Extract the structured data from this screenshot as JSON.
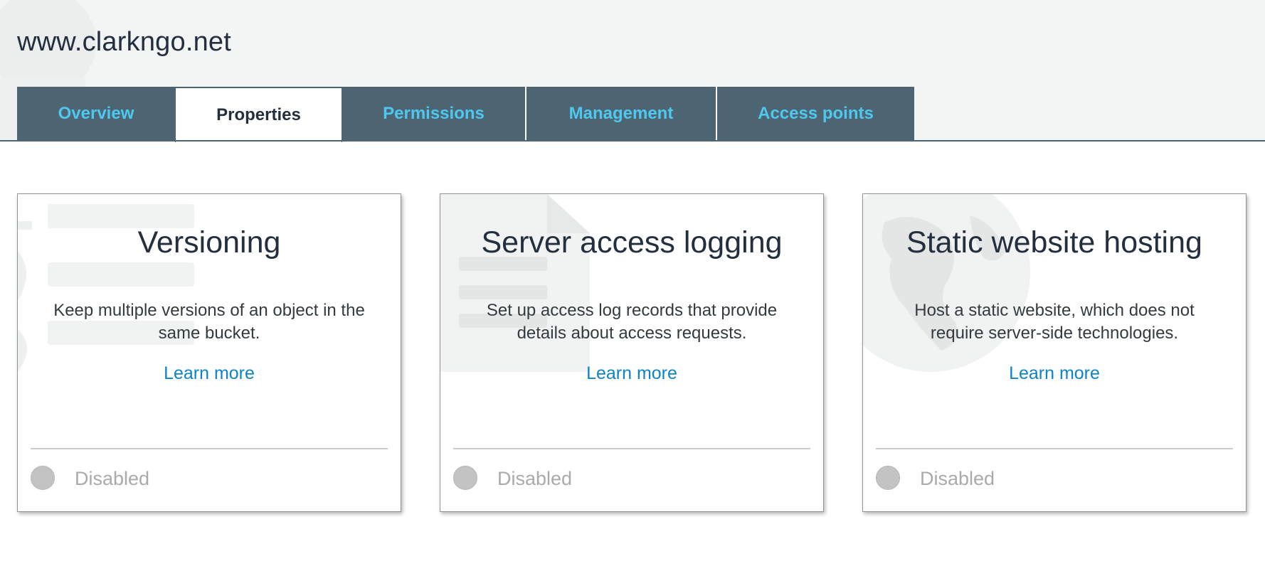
{
  "bucket": {
    "title": "www.clarkngo.net"
  },
  "tabs": [
    {
      "label": "Overview",
      "active": false
    },
    {
      "label": "Properties",
      "active": true
    },
    {
      "label": "Permissions",
      "active": false
    },
    {
      "label": "Management",
      "active": false
    },
    {
      "label": "Access points",
      "active": false
    }
  ],
  "cards": [
    {
      "title": "Versioning",
      "description": "Keep multiple versions of an object in the same bucket.",
      "link": "Learn more",
      "status": "Disabled",
      "icon": "versioning-stack-icon"
    },
    {
      "title": "Server access logging",
      "description": "Set up access log records that provide details about access requests.",
      "link": "Learn more",
      "status": "Disabled",
      "icon": "log-document-icon"
    },
    {
      "title": "Static website hosting",
      "description": "Host a static website, which does not require server-side technologies.",
      "link": "Learn more",
      "status": "Disabled",
      "icon": "globe-icon"
    }
  ],
  "colors": {
    "tab_background": "#4d6472",
    "tab_text": "#4fc8f0",
    "link": "#0f84c4",
    "disabled": "#a9aaab"
  }
}
